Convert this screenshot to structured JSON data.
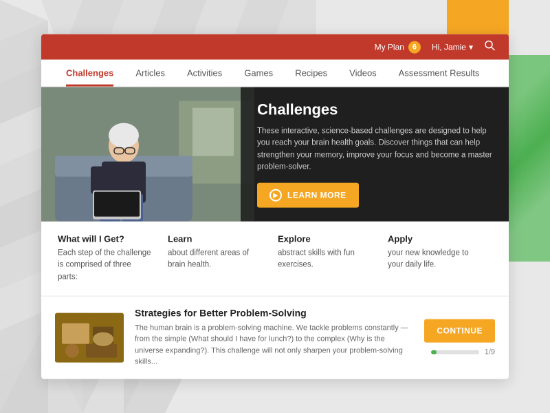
{
  "background": {
    "yellowAccent": "#f5a623",
    "greenAccent": "#4caf50"
  },
  "topbar": {
    "myPlanLabel": "My Plan",
    "planCount": "6",
    "userLabel": "Hi, Jamie",
    "searchIcon": "search-icon"
  },
  "nav": {
    "items": [
      {
        "label": "Challenges",
        "active": true
      },
      {
        "label": "Articles",
        "active": false
      },
      {
        "label": "Activities",
        "active": false
      },
      {
        "label": "Games",
        "active": false
      },
      {
        "label": "Recipes",
        "active": false
      },
      {
        "label": "Videos",
        "active": false
      },
      {
        "label": "Assessment Results",
        "active": false
      }
    ]
  },
  "hero": {
    "title": "Challenges",
    "description": "These interactive, science-based challenges are designed to help you reach your brain health goals. Discover things that can help strengthen your memory, improve your focus and become a master problem-solver.",
    "learnMoreLabel": "LEARN MORE"
  },
  "infoSection": {
    "col1": {
      "title": "What will I Get?",
      "text": "Each step of the challenge is comprised of three parts:"
    },
    "col2": {
      "title": "Learn",
      "text": "about different areas of brain health."
    },
    "col3": {
      "title": "Explore",
      "text": "abstract skills with fun exercises."
    },
    "col4": {
      "title": "Apply",
      "text": "your new knowledge to your daily life."
    }
  },
  "challengeCard": {
    "title": "Strategies for Better Problem-Solving",
    "description": "The human brain is a problem-solving machine. We tackle problems constantly — from the simple (What should I have for lunch?) to the complex (Why is the universe expanding?). This challenge will not only sharpen your problem-solving skills...",
    "continueLabel": "CONTINUE",
    "progress": "1/9",
    "progressPercent": 12
  }
}
